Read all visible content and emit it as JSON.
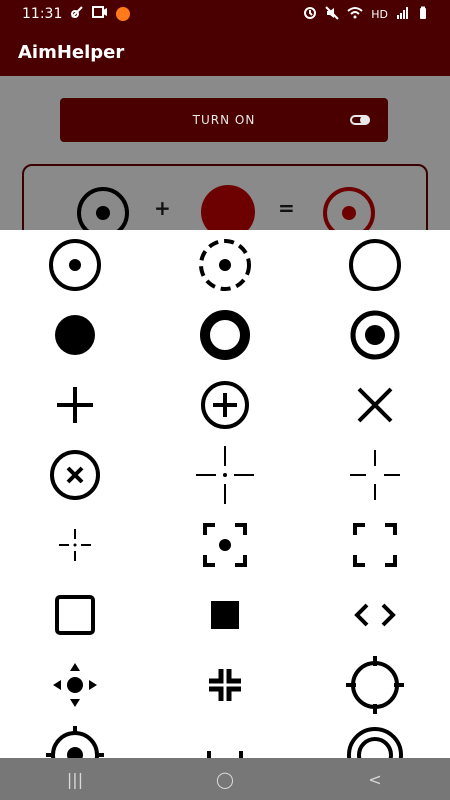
{
  "status": {
    "time": "11:31",
    "right_text": "HD"
  },
  "app": {
    "title": "AimHelper"
  },
  "controls": {
    "turn_on_label": "TURN ON"
  },
  "formula": {
    "plus": "+",
    "equals": "="
  },
  "nav": {
    "recent": "|||",
    "home": "◯",
    "back": "<"
  },
  "colors": {
    "primary_dark": "#4a0000",
    "accent_red": "#6d0000",
    "sheet_bg": "#ffffff",
    "icon_black": "#000000"
  }
}
